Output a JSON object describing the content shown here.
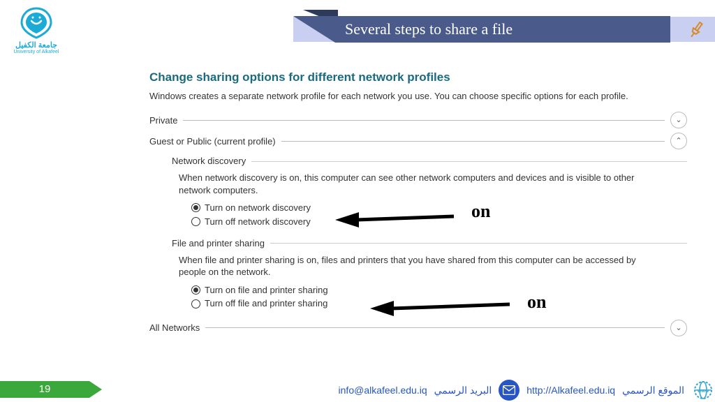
{
  "logo": {
    "line1": "جامعة الكفيل",
    "line2": "University of Alkafeel"
  },
  "title": "Several steps to share a file",
  "panel": {
    "heading": "Change sharing options for different network profiles",
    "intro": "Windows creates a separate network profile for each network you use. You can choose specific options for each profile.",
    "sections": {
      "private": "Private",
      "guest": "Guest or Public (current profile)",
      "all": "All Networks"
    },
    "netdisc": {
      "title": "Network discovery",
      "desc": "When network discovery is on, this computer can see other network computers and devices and is visible to other network computers.",
      "opt_on": "Turn on network discovery",
      "opt_off": "Turn off network discovery"
    },
    "fps": {
      "title": "File and printer sharing",
      "desc": "When file and printer sharing is on, files and printers that you have shared from this computer can be accessed by people on the network.",
      "opt_on": "Turn on file and printer sharing",
      "opt_off": "Turn off file and printer sharing"
    }
  },
  "annotations": {
    "on": "on"
  },
  "footer": {
    "page": "19",
    "email": "info@alkafeel.edu.iq",
    "email_label": "البريد الرسمي",
    "site": "http://Alkafeel.edu.iq",
    "site_label": "الموقع الرسمي"
  }
}
